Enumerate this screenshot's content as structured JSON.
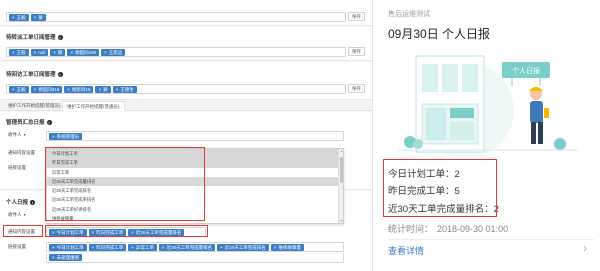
{
  "save_label": "保存",
  "top_section": {
    "tags": [
      "王毅",
      "蒙"
    ]
  },
  "section_pending": {
    "title": "待转派工单订阅管理",
    "tags": [
      "王毅",
      "null",
      "颖",
      "杨超同190",
      "王思远"
    ]
  },
  "section_dispatched": {
    "title": "待回访工单订阅管理",
    "tags": [
      "王毅",
      "杨思同315",
      "杨思同16",
      "颖",
      "王德生"
    ]
  },
  "tabs": [
    "维护工作开始提醒(管理员)",
    "维护工作开始提醒(普通员)"
  ],
  "manager_report": {
    "title": "管理员汇总日报",
    "recipient_label": "收件人",
    "tag": "系统管理员",
    "notify_label": "通知内容设置",
    "content_label": "链接设置",
    "dropdown_items": [
      "今日计划工单",
      "昨日完成工单",
      "异常工单",
      "近30天工单完成量排名",
      "近30天工单完成排名",
      "近30天工单完成率排名",
      "近30天工单好评排名",
      "维修故障量"
    ],
    "dropdown_highlighted": [
      0,
      1,
      3
    ]
  },
  "personal_report": {
    "title": "个人日报",
    "recipient_label": "收件人",
    "notify_label": "通知内容设置",
    "content_label": "链接设置",
    "tags_row1": [
      "今日计划工单",
      "昨日完成工单",
      "近30天工单完成量排名"
    ],
    "tags_row2": [
      "今日计划工单",
      "昨日完成工单",
      "异常工单",
      "近30天工单完成量排名",
      "近30天工单完成排名",
      "维修故障量"
    ],
    "tags_row3": [
      "未处理维修"
    ]
  },
  "mobile": {
    "subtitle": "售后运维测试",
    "title": "09月30日 个人日报",
    "illustration_sign": "个人日报",
    "line1": "今日计划工单：2",
    "line2": "昨日完成工单：5",
    "line3": "近30天工单完成量排名：2",
    "stat_label": "统计时间：",
    "stat_time": "2018-09-30 01:00",
    "link": "查看详情"
  },
  "colors": {
    "tag_blue": "#3c7ec6",
    "highlight_red": "#e53935",
    "illus_green": "#7ad0c8",
    "link_blue": "#3b78c4"
  }
}
